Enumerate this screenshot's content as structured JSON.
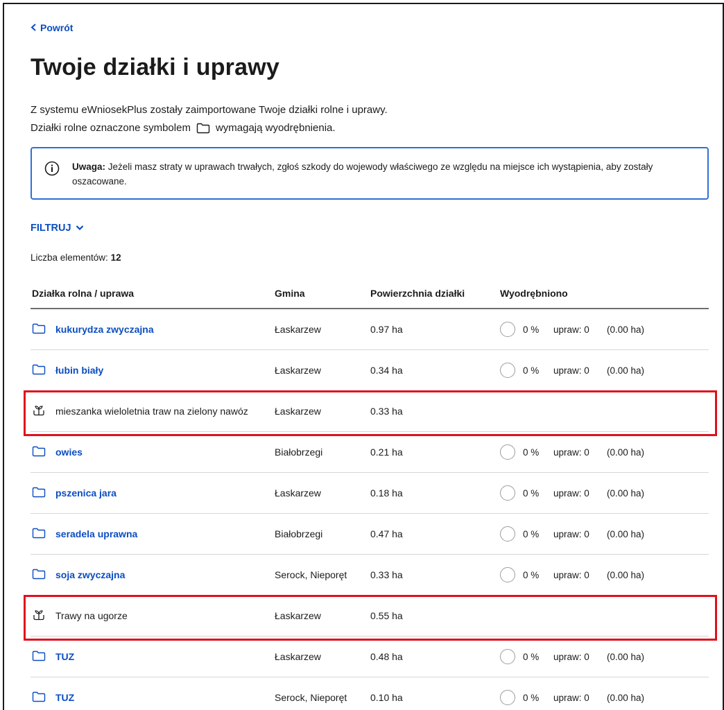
{
  "nav": {
    "back_label": "Powrót"
  },
  "page": {
    "title": "Twoje działki i uprawy",
    "intro_line1": "Z systemu eWniosekPlus zostały zaimportowane Twoje działki rolne i uprawy.",
    "intro_line2_before": "Działki rolne oznaczone symbolem",
    "intro_line2_after": "wymagają wyodrębnienia."
  },
  "notice": {
    "label": "Uwaga:",
    "text": " Jeżeli masz straty w uprawach trwałych, zgłoś szkody do wojewody właściwego ze względu na miejsce ich wystąpienia, aby zostały oszacowane."
  },
  "filter": {
    "label": "FILTRUJ"
  },
  "count": {
    "label": "Liczba elementów:",
    "value": "12"
  },
  "table": {
    "headers": {
      "parcel": "Działka rolna / uprawa",
      "commune": "Gmina",
      "area": "Powierzchnia działki",
      "extracted": "Wyodrębniono"
    },
    "rows": [
      {
        "name": "kukurydza zwyczajna",
        "commune": "Łaskarzew",
        "area": "0.97 ha",
        "pct": "0 %",
        "crops": "upraw: 0",
        "ha": "(0.00 ha)",
        "kind": "folder",
        "progress": 0
      },
      {
        "name": "łubin biały",
        "commune": "Łaskarzew",
        "area": "0.34 ha",
        "pct": "0 %",
        "crops": "upraw: 0",
        "ha": "(0.00 ha)",
        "kind": "folder",
        "progress": 0
      },
      {
        "name": "mieszanka wieloletnia traw na zielony nawóz",
        "commune": "Łaskarzew",
        "area": "0.33 ha",
        "pct": "",
        "crops": "",
        "ha": "",
        "kind": "crop",
        "progress": null
      },
      {
        "name": "owies",
        "commune": "Białobrzegi",
        "area": "0.21 ha",
        "pct": "0 %",
        "crops": "upraw: 0",
        "ha": "(0.00 ha)",
        "kind": "folder",
        "progress": 0
      },
      {
        "name": "pszenica jara",
        "commune": "Łaskarzew",
        "area": "0.18 ha",
        "pct": "0 %",
        "crops": "upraw: 0",
        "ha": "(0.00 ha)",
        "kind": "folder",
        "progress": 0
      },
      {
        "name": "seradela uprawna",
        "commune": "Białobrzegi",
        "area": "0.47 ha",
        "pct": "0 %",
        "crops": "upraw: 0",
        "ha": "(0.00 ha)",
        "kind": "folder",
        "progress": 0
      },
      {
        "name": "soja zwyczajna",
        "commune": "Serock, Nieporęt",
        "area": "0.33 ha",
        "pct": "0 %",
        "crops": "upraw: 0",
        "ha": "(0.00 ha)",
        "kind": "folder",
        "progress": 0
      },
      {
        "name": "Trawy na ugorze",
        "commune": "Łaskarzew",
        "area": "0.55 ha",
        "pct": "",
        "crops": "",
        "ha": "",
        "kind": "crop",
        "progress": null
      },
      {
        "name": "TUZ",
        "commune": "Łaskarzew",
        "area": "0.48 ha",
        "pct": "0 %",
        "crops": "upraw: 0",
        "ha": "(0.00 ha)",
        "kind": "folder",
        "progress": 0
      },
      {
        "name": "TUZ",
        "commune": "Serock, Nieporęt",
        "area": "0.10 ha",
        "pct": "0 %",
        "crops": "upraw: 0",
        "ha": "(0.00 ha)",
        "kind": "folder",
        "progress": 0
      }
    ]
  },
  "colors": {
    "link": "#0b4dc1",
    "highlight": "#e0101c",
    "notice_border": "#2f6fd6"
  },
  "icons": {
    "folder": "folder-icon",
    "crop": "plant-icon",
    "info": "info-icon",
    "back": "chevron-left-icon",
    "filter": "chevron-down-icon"
  }
}
